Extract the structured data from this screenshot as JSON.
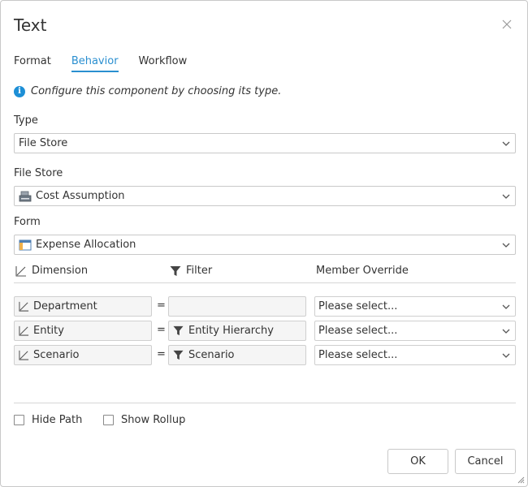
{
  "dialog": {
    "title": "Text"
  },
  "tabs": [
    {
      "label": "Format",
      "active": false
    },
    {
      "label": "Behavior",
      "active": true
    },
    {
      "label": "Workflow",
      "active": false
    }
  ],
  "info": {
    "text": "Configure this component by choosing its type."
  },
  "type": {
    "label": "Type",
    "value": "File Store"
  },
  "file_store": {
    "label": "File Store",
    "value": "Cost Assumption",
    "icon": "file-store-icon"
  },
  "form": {
    "label": "Form",
    "value": "Expense Allocation",
    "icon": "form-icon"
  },
  "grid": {
    "headers": {
      "dimension": "Dimension",
      "filter": "Filter",
      "override": "Member Override"
    },
    "rows": [
      {
        "dimension": "Department",
        "filter": "",
        "override": "Please select..."
      },
      {
        "dimension": "Entity",
        "filter": "Entity Hierarchy",
        "override": "Please select..."
      },
      {
        "dimension": "Scenario",
        "filter": "Scenario",
        "override": "Please select..."
      }
    ]
  },
  "options": {
    "hide_path": "Hide Path",
    "show_rollup": "Show Rollup"
  },
  "buttons": {
    "ok": "OK",
    "cancel": "Cancel"
  },
  "colors": {
    "accent": "#2a8fd0",
    "info": "#1d8fd6"
  }
}
